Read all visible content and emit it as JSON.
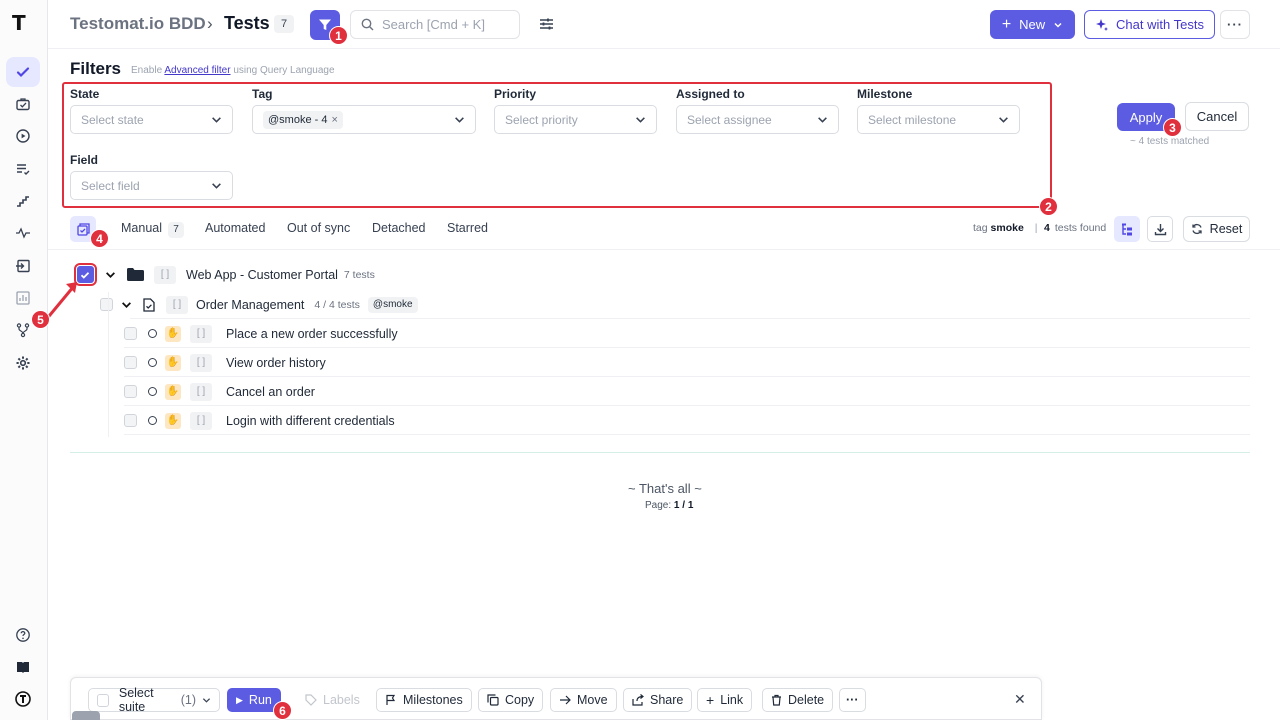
{
  "sidebar": {
    "logo": "T",
    "items": [
      {
        "name": "tests",
        "active": true
      },
      {
        "name": "runs"
      },
      {
        "name": "runs-play"
      },
      {
        "name": "plans"
      },
      {
        "name": "steps"
      },
      {
        "name": "pulse"
      },
      {
        "name": "import"
      },
      {
        "name": "analytics"
      },
      {
        "name": "branches"
      },
      {
        "name": "settings"
      }
    ],
    "bottom": [
      "help",
      "docs",
      "account"
    ]
  },
  "header": {
    "project": "Testomat.io BDD",
    "separator": "›",
    "title": "Tests",
    "count": "7",
    "search_placeholder": "Search [Cmd + K]",
    "new_label": "New",
    "chat_label": "Chat with Tests",
    "more_label": "···"
  },
  "filters": {
    "title": "Filters",
    "hint_prefix": "Enable",
    "hint_link": "Advanced filter",
    "hint_suffix": "using Query Language",
    "state": {
      "label": "State",
      "placeholder": "Select state"
    },
    "tag": {
      "label": "Tag",
      "chip": "@smoke - 4",
      "chip_remove": "×"
    },
    "priority": {
      "label": "Priority",
      "placeholder": "Select priority"
    },
    "assigned": {
      "label": "Assigned to",
      "placeholder": "Select assignee"
    },
    "milestone": {
      "label": "Milestone",
      "placeholder": "Select milestone"
    },
    "field": {
      "label": "Field",
      "placeholder": "Select field"
    },
    "apply_label": "Apply",
    "cancel_label": "Cancel",
    "matched": "~ 4 tests matched"
  },
  "tabs": {
    "items": [
      {
        "label": "Manual",
        "count": "7"
      },
      {
        "label": "Automated"
      },
      {
        "label": "Out of sync"
      },
      {
        "label": "Detached"
      },
      {
        "label": "Starred"
      }
    ],
    "tag_prefix": "tag",
    "tag_value": "smoke",
    "divider": "|",
    "found_count": "4",
    "found_label": "tests found",
    "reset_label": "Reset"
  },
  "tree": {
    "suite": {
      "id": "[ ]",
      "title": "Web App - Customer Portal",
      "meta": "7 tests"
    },
    "group": {
      "id": "[ ]",
      "title": "Order Management",
      "meta": "4 / 4 tests",
      "tag": "@smoke"
    },
    "tests": [
      {
        "id": "[ ]",
        "title": "Place a new order successfully"
      },
      {
        "id": "[ ]",
        "title": "View order history"
      },
      {
        "id": "[ ]",
        "title": "Cancel an order"
      },
      {
        "id": "[ ]",
        "title": "Login with different credentials"
      }
    ],
    "end_text": "~ That's all ~",
    "page_label": "Page:",
    "page_value": "1 / 1"
  },
  "bottom_bar": {
    "select_suite": "Select suite",
    "select_suite_count": "(1)",
    "run": "Run",
    "labels": "Labels",
    "milestones": "Milestones",
    "copy": "Copy",
    "move": "Move",
    "share": "Share",
    "link": "Link",
    "delete": "Delete",
    "more": "···",
    "close": "✕"
  },
  "callouts": [
    "1",
    "2",
    "3",
    "4",
    "5",
    "6"
  ],
  "colors": {
    "accent": "#5b5ce2",
    "highlight": "#e0303e"
  }
}
